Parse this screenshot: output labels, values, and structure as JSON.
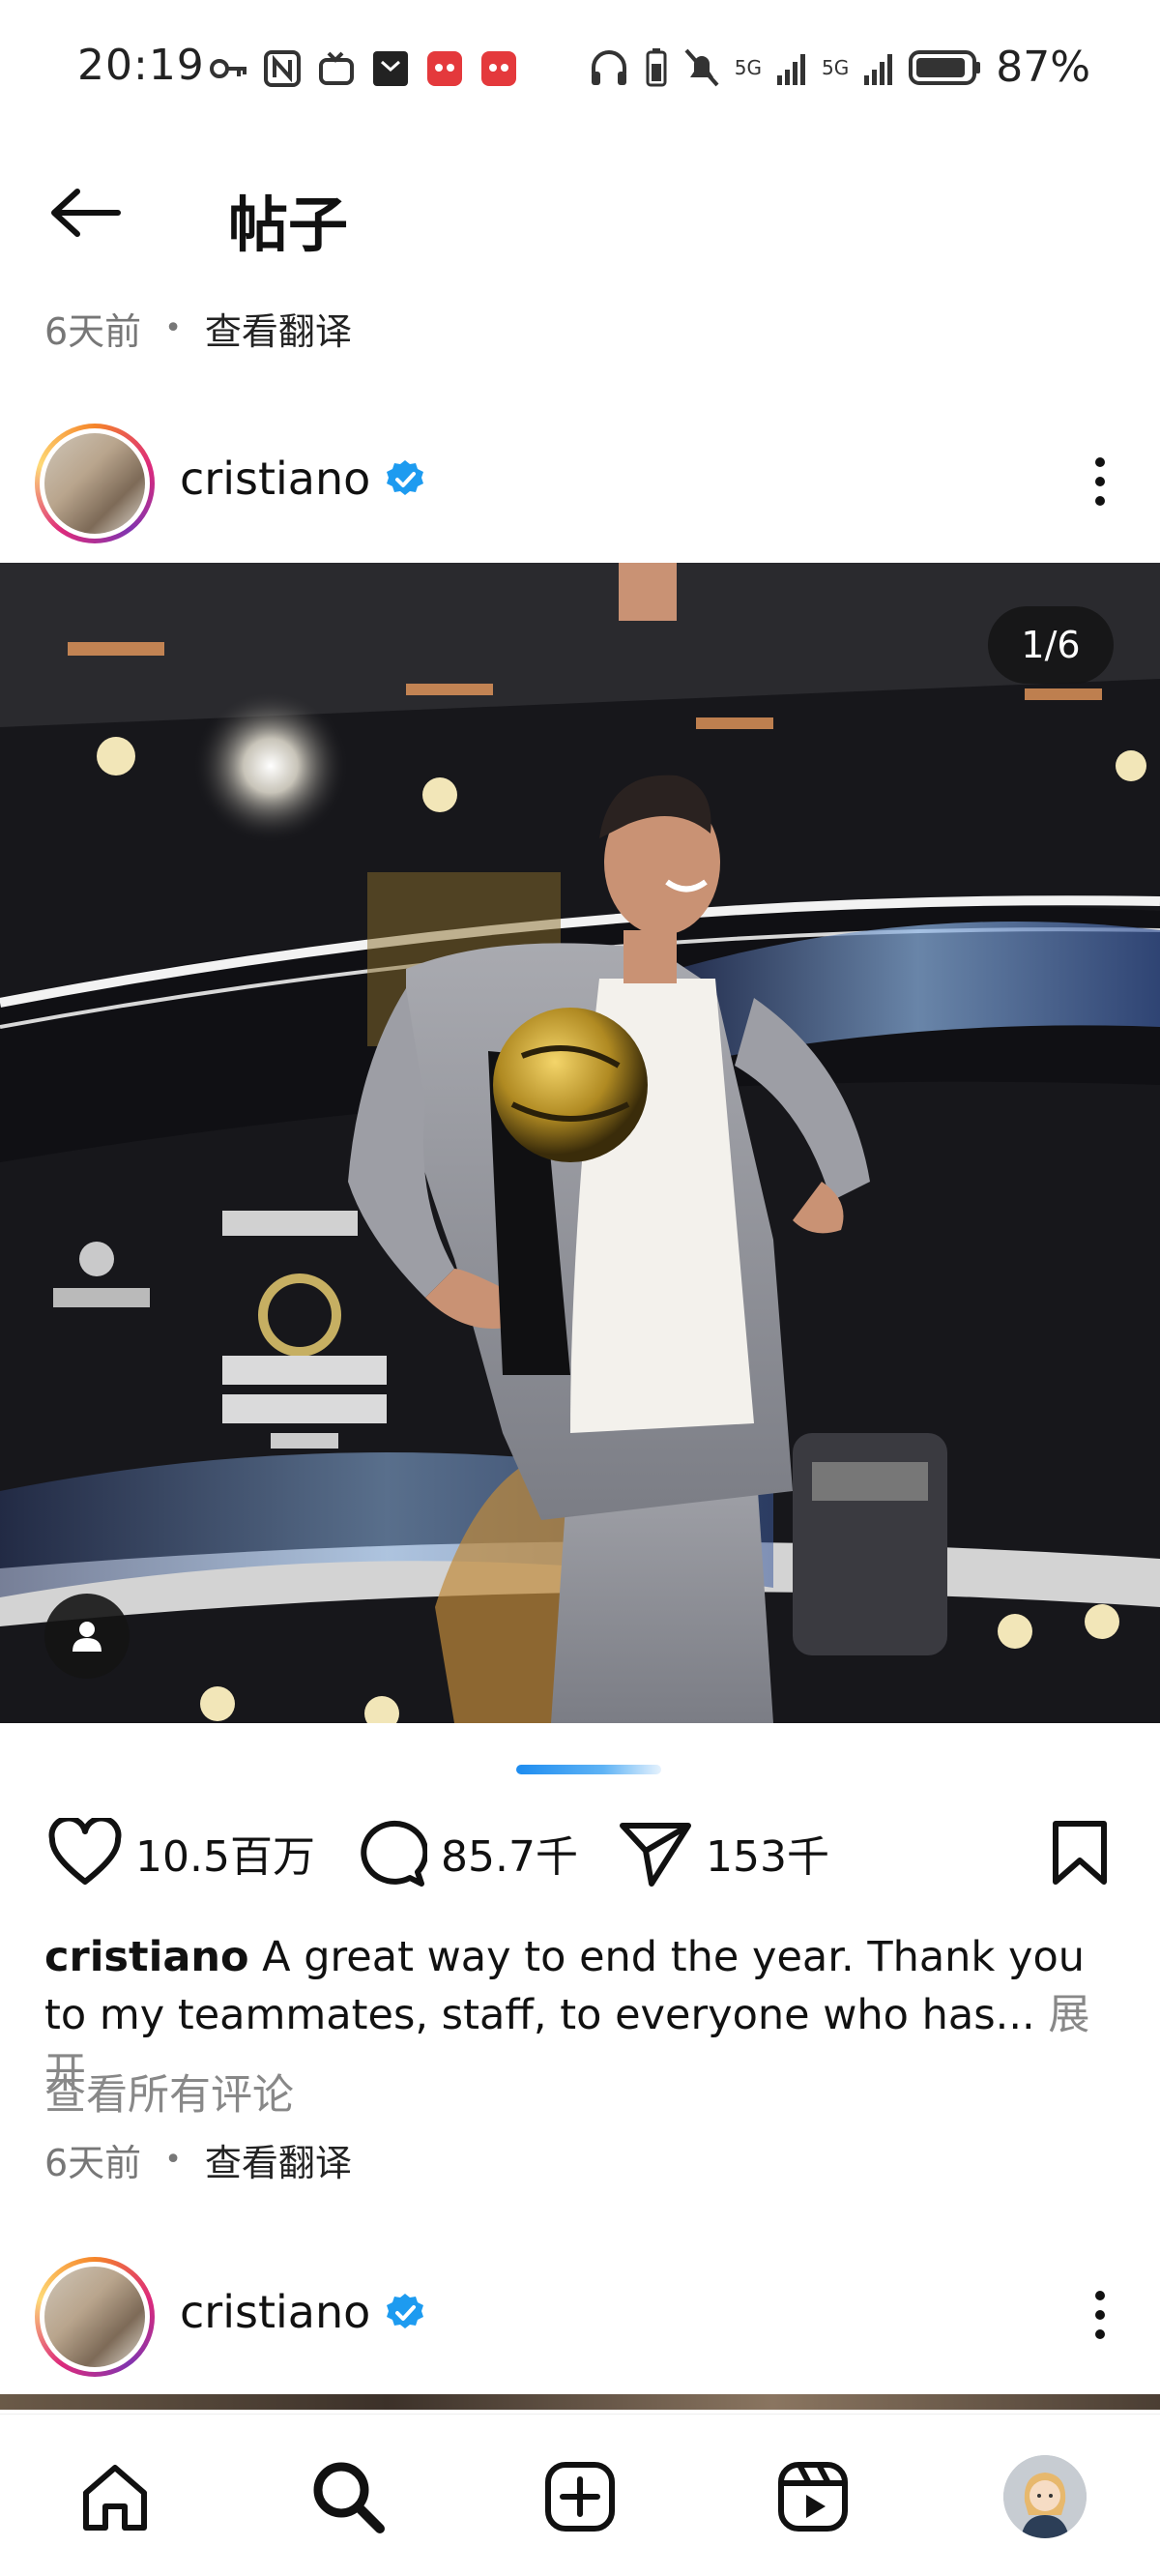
{
  "status_bar": {
    "time": "20:19",
    "battery_percent": "87%",
    "network_1": "5G",
    "network_2": "5G"
  },
  "header": {
    "title": "帖子"
  },
  "top_meta": {
    "time_ago": "6天前",
    "dot": "•",
    "translate": "查看翻译"
  },
  "post": {
    "author": "cristiano",
    "verified": true,
    "carousel_counter": "1/6",
    "carousel_position": 1,
    "carousel_total": 6,
    "image_description_icons": "person-tag-icon",
    "likes": "10.5百万",
    "comments": "85.7千",
    "shares": "153千",
    "caption_user": "cristiano",
    "caption_text": " A great way to end the year. Thank you to my teammates, staff, to everyone who has...",
    "caption_more": " 展开",
    "view_all_comments": "查看所有评论",
    "time_ago": "6天前",
    "dot": "•",
    "translate": "查看翻译"
  },
  "next_post": {
    "author": "cristiano",
    "verified": true
  },
  "colors": {
    "verified_blue": "#1d9bf0",
    "carousel_active": "#1d8cf0",
    "text_primary": "#111111",
    "text_secondary": "#888888"
  }
}
